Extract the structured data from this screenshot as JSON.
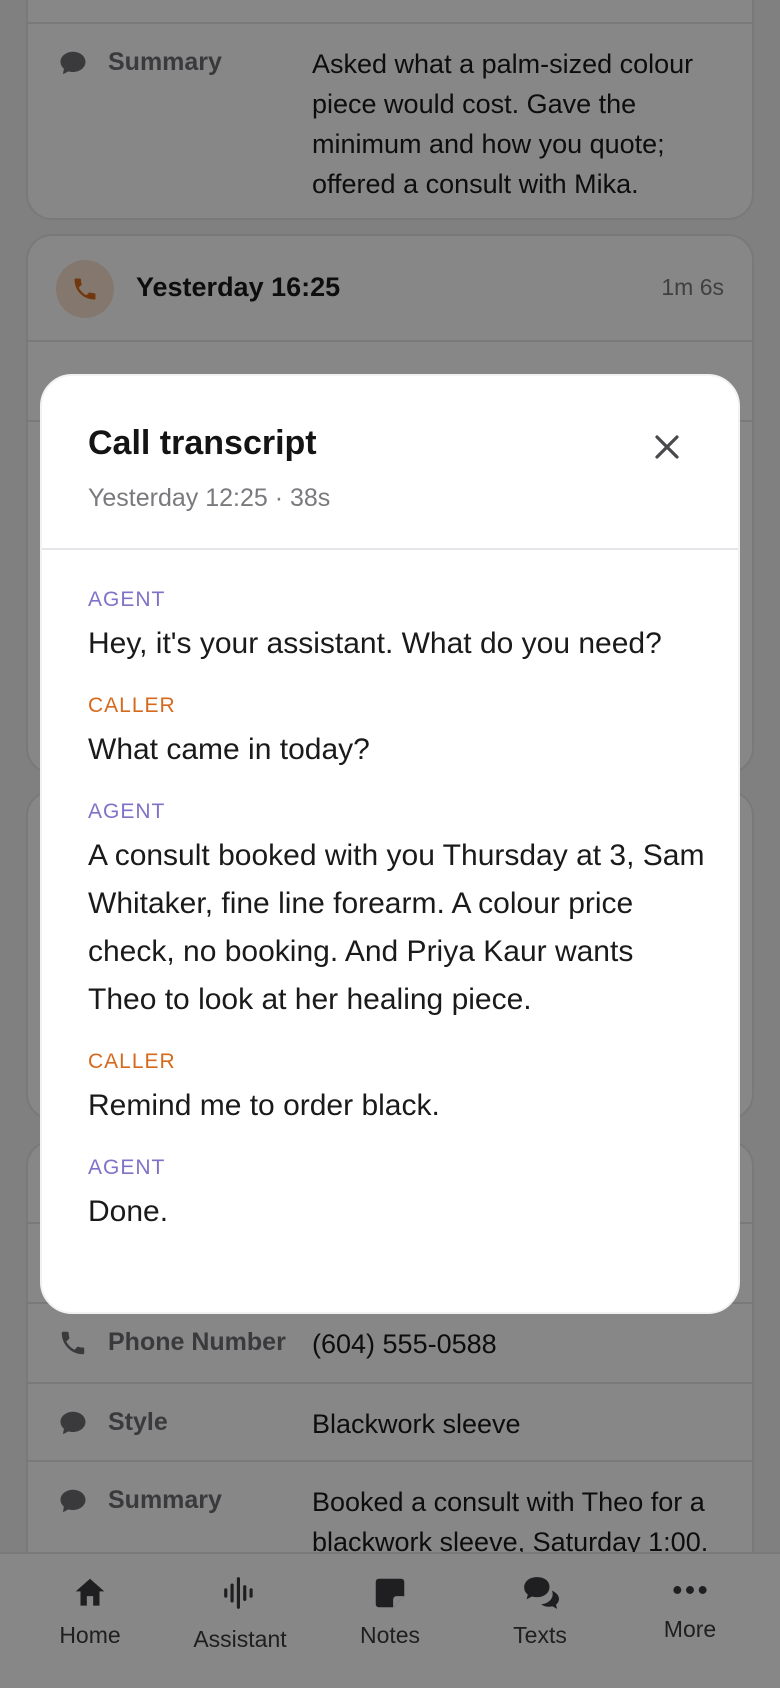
{
  "background": {
    "top_summary": {
      "label": "Summary",
      "value": "Asked what a palm-sized colour piece would cost. Gave the minimum and how you quote; offered a consult with Mika."
    },
    "call": {
      "when": "Yesterday 16:25",
      "duration": "1m 6s"
    },
    "lower_rows": [
      {
        "label": "Phone Number",
        "value": "(604) 555-0588"
      },
      {
        "label": "Style",
        "value": "Blackwork sleeve"
      },
      {
        "label": "Summary",
        "value": "Booked a consult with Theo for a blackwork sleeve, Saturday 1:00."
      }
    ]
  },
  "modal": {
    "title": "Call transcript",
    "subtitle": "Yesterday 12:25 · 38s",
    "turns": [
      {
        "speaker": "AGENT",
        "text": "Hey, it's your assistant. What do you need?"
      },
      {
        "speaker": "CALLER",
        "text": "What came in today?"
      },
      {
        "speaker": "AGENT",
        "text": "A consult booked with you Thursday at 3, Sam Whitaker, fine line forearm. A colour price check, no booking. And Priya Kaur wants Theo to look at her healing piece."
      },
      {
        "speaker": "CALLER",
        "text": "Remind me to order black."
      },
      {
        "speaker": "AGENT",
        "text": "Done."
      }
    ]
  },
  "tabbar": {
    "items": [
      {
        "label": "Home",
        "icon": "home-icon"
      },
      {
        "label": "Assistant",
        "icon": "waveform-icon"
      },
      {
        "label": "Notes",
        "icon": "note-icon"
      },
      {
        "label": "Texts",
        "icon": "chat-bubbles-icon"
      },
      {
        "label": "More",
        "icon": "more-dots-icon"
      }
    ]
  },
  "colors": {
    "agent": "#7f72c8",
    "caller": "#d56a1e",
    "overlay": "rgba(0,0,0,0.47)"
  }
}
